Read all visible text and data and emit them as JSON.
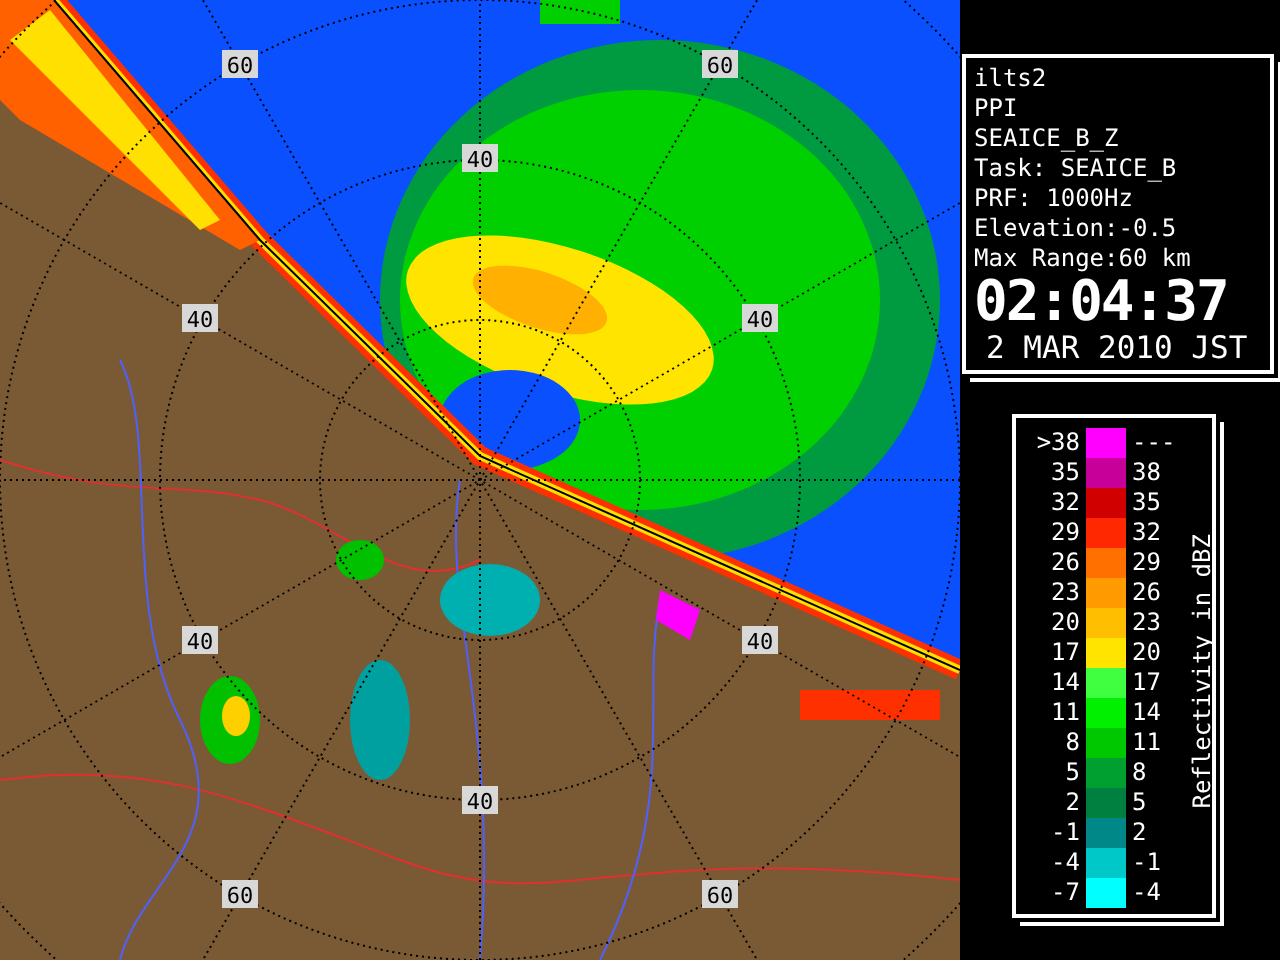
{
  "map": {
    "range_labels": [
      {
        "text": "60"
      },
      {
        "text": "60"
      },
      {
        "text": "40"
      },
      {
        "text": "40"
      },
      {
        "text": "40"
      },
      {
        "text": "40"
      },
      {
        "text": "40"
      },
      {
        "text": "40"
      },
      {
        "text": "60"
      },
      {
        "text": "60"
      }
    ]
  },
  "info_panel": {
    "lines": [
      "ilts2",
      "PPI",
      "SEAICE_B_Z",
      "Task: SEAICE_B",
      "PRF: 1000Hz",
      "Elevation:-0.5",
      "Max Range:60 km"
    ],
    "time": "02:04:37",
    "date": "2 MAR 2010 JST"
  },
  "legend": {
    "title": "Reflectivity in dBZ",
    "rows": [
      {
        "low": ">38",
        "high": "---",
        "color": "#ff00ff"
      },
      {
        "low": "35",
        "high": "38",
        "color": "#c8009a"
      },
      {
        "low": "32",
        "high": "35",
        "color": "#d00000"
      },
      {
        "low": "29",
        "high": "32",
        "color": "#ff2800"
      },
      {
        "low": "26",
        "high": "29",
        "color": "#ff7000"
      },
      {
        "low": "23",
        "high": "26",
        "color": "#ff9a00"
      },
      {
        "low": "20",
        "high": "23",
        "color": "#ffbe00"
      },
      {
        "low": "17",
        "high": "20",
        "color": "#ffe400"
      },
      {
        "low": "14",
        "high": "17",
        "color": "#40ff40"
      },
      {
        "low": "11",
        "high": "14",
        "color": "#00f000"
      },
      {
        "low": "8",
        "high": "11",
        "color": "#00c800"
      },
      {
        "low": "5",
        "high": "8",
        "color": "#00a030"
      },
      {
        "low": "2",
        "high": "5",
        "color": "#008040"
      },
      {
        "low": "-1",
        "high": "2",
        "color": "#008888"
      },
      {
        "low": "-4",
        "high": "-1",
        "color": "#00c8c8"
      },
      {
        "low": "-7",
        "high": "-4",
        "color": "#00ffff"
      }
    ]
  }
}
